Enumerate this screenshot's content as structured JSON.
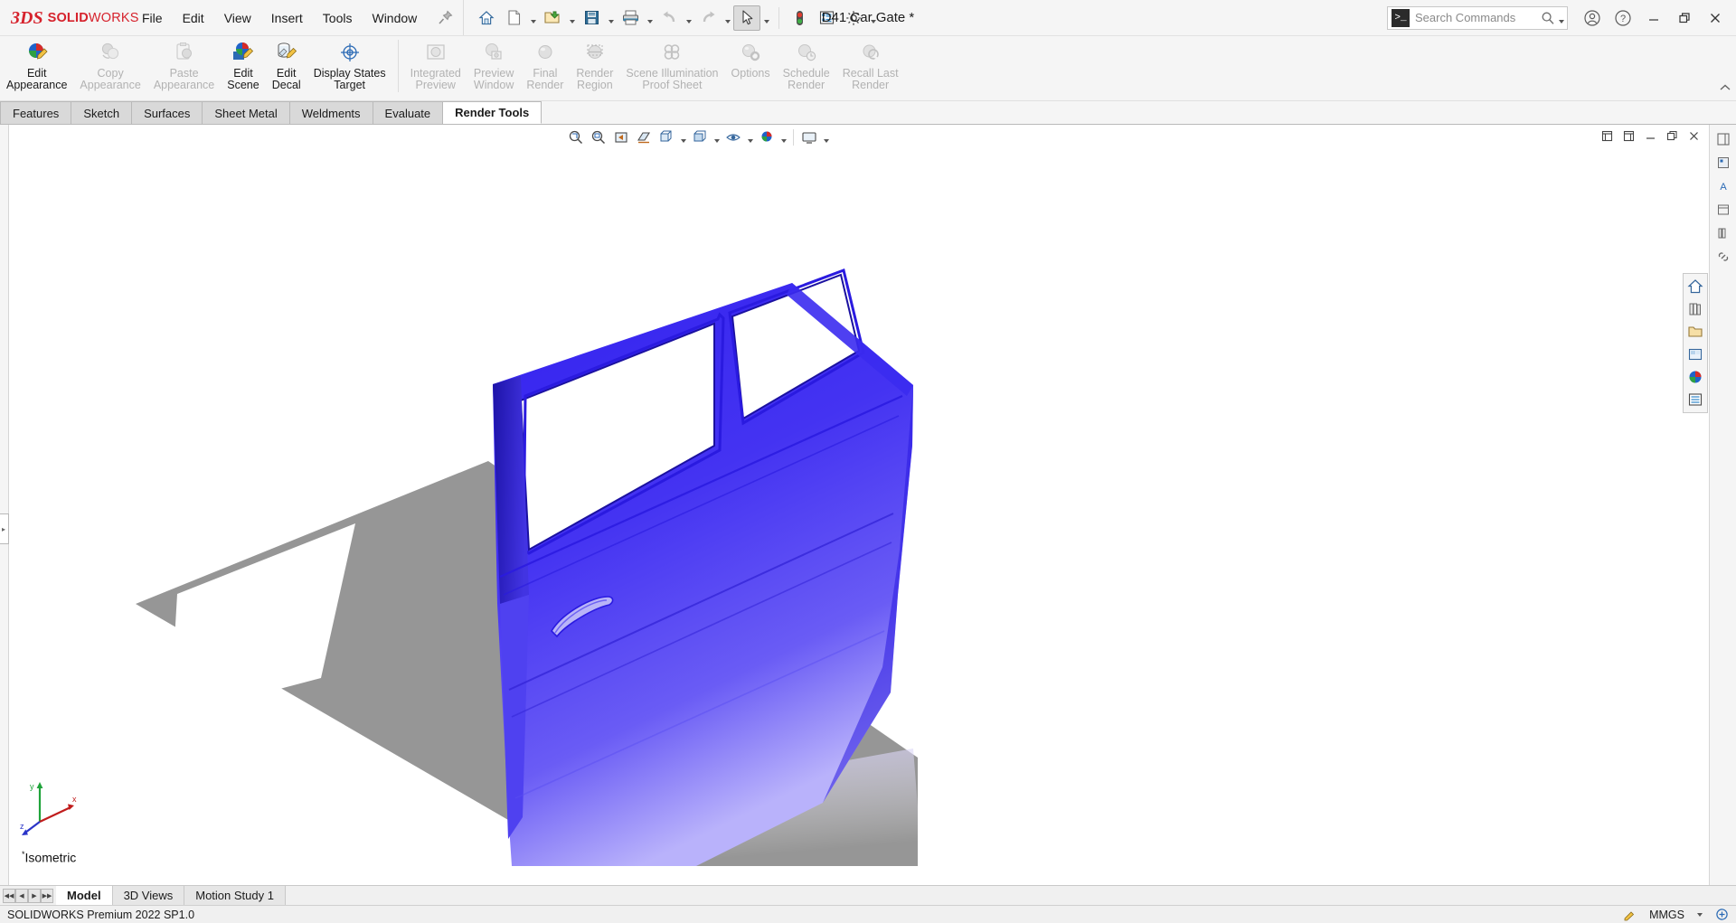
{
  "app": {
    "brand_bold": "SOLID",
    "brand_light": "WORKS",
    "accent_color": "#d6222c",
    "document_title": "D41 Car Gate *"
  },
  "menu": {
    "items": [
      {
        "label": "File",
        "name": "menu-file"
      },
      {
        "label": "Edit",
        "name": "menu-edit"
      },
      {
        "label": "View",
        "name": "menu-view"
      },
      {
        "label": "Insert",
        "name": "menu-insert"
      },
      {
        "label": "Tools",
        "name": "menu-tools"
      },
      {
        "label": "Window",
        "name": "menu-window"
      }
    ],
    "pin_icon": "pin-icon"
  },
  "quick_access": {
    "buttons": [
      {
        "name": "home-button",
        "icon": "home-icon",
        "has_caret": false
      },
      {
        "name": "new-document-button",
        "icon": "new-document-icon",
        "has_caret": true
      },
      {
        "name": "open-button",
        "icon": "open-folder-icon",
        "has_caret": true
      },
      {
        "name": "save-button",
        "icon": "save-floppy-icon",
        "has_caret": true
      },
      {
        "name": "print-button",
        "icon": "printer-icon",
        "has_caret": true
      },
      {
        "name": "undo-button",
        "icon": "undo-arrow-icon",
        "has_caret": true,
        "disabled": true
      },
      {
        "name": "redo-button",
        "icon": "redo-arrow-icon",
        "has_caret": true,
        "disabled": true
      },
      {
        "name": "select-button",
        "icon": "cursor-arrow-icon",
        "has_caret": true,
        "selected": true
      },
      {
        "name": "rebuild-button",
        "icon": "traffic-light-icon",
        "has_caret": false
      },
      {
        "name": "file-properties-button",
        "icon": "properties-list-icon",
        "has_caret": false
      },
      {
        "name": "options-button",
        "icon": "gear-icon",
        "has_caret": true
      }
    ]
  },
  "search": {
    "placeholder": "Search Commands",
    "prompt_glyph": ">_",
    "magnifier_icon": "search-icon",
    "caret_icon": "chevron-down-icon"
  },
  "window_controls": {
    "account_icon": "user-account-icon",
    "help_icon": "help-question-icon",
    "minimize": "–",
    "restore": "❐",
    "close": "✕"
  },
  "ribbon": {
    "groups": [
      {
        "name": "appearance-group",
        "buttons": [
          {
            "label": "Edit\nAppearance",
            "name": "edit-appearance-button",
            "icon": "appearance-sphere-pencil-icon",
            "disabled": false
          },
          {
            "label": "Copy\nAppearance",
            "name": "copy-appearance-button",
            "icon": "copy-appearance-icon",
            "disabled": true
          },
          {
            "label": "Paste\nAppearance",
            "name": "paste-appearance-button",
            "icon": "paste-appearance-icon",
            "disabled": true
          },
          {
            "label": "Edit\nScene",
            "name": "edit-scene-button",
            "icon": "scene-icon",
            "disabled": false
          },
          {
            "label": "Edit\nDecal",
            "name": "edit-decal-button",
            "icon": "decal-icon",
            "disabled": false
          },
          {
            "label": "Display States",
            "name": "display-states-button",
            "icon": "display-states-target-icon",
            "disabled": false,
            "sublabel": "Target"
          }
        ]
      },
      {
        "name": "render-group",
        "buttons": [
          {
            "label": "Integrated\nPreview",
            "name": "integrated-preview-button",
            "icon": "integrated-preview-icon",
            "disabled": true
          },
          {
            "label": "Preview\nWindow",
            "name": "preview-window-button",
            "icon": "preview-window-icon",
            "disabled": true
          },
          {
            "label": "Final\nRender",
            "name": "final-render-button",
            "icon": "final-render-sphere-icon",
            "disabled": true
          },
          {
            "label": "Render\nRegion",
            "name": "render-region-button",
            "icon": "render-region-icon",
            "disabled": true
          },
          {
            "label": "Scene Illumination\nProof Sheet",
            "name": "scene-illumination-proof-sheet-button",
            "icon": "proof-sheet-spheres-icon",
            "disabled": true
          },
          {
            "label": "Options",
            "name": "render-options-button",
            "icon": "render-options-gear-icon",
            "disabled": true
          },
          {
            "label": "Schedule\nRender",
            "name": "schedule-render-button",
            "icon": "schedule-render-icon",
            "disabled": true
          },
          {
            "label": "Recall Last\nRender",
            "name": "recall-last-render-button",
            "icon": "recall-last-render-icon",
            "disabled": true
          }
        ]
      }
    ],
    "collapse_icon": "chevron-up-icon"
  },
  "command_tabs": [
    {
      "label": "Features",
      "name": "tab-features",
      "active": false
    },
    {
      "label": "Sketch",
      "name": "tab-sketch",
      "active": false
    },
    {
      "label": "Surfaces",
      "name": "tab-surfaces",
      "active": false
    },
    {
      "label": "Sheet Metal",
      "name": "tab-sheet-metal",
      "active": false
    },
    {
      "label": "Weldments",
      "name": "tab-weldments",
      "active": false
    },
    {
      "label": "Evaluate",
      "name": "tab-evaluate",
      "active": false
    },
    {
      "label": "Render Tools",
      "name": "tab-render-tools",
      "active": true
    }
  ],
  "view_toolbar": {
    "buttons": [
      {
        "name": "zoom-to-fit-button",
        "icon": "zoom-to-fit-icon",
        "caret": false
      },
      {
        "name": "zoom-to-area-button",
        "icon": "zoom-to-area-icon",
        "caret": false
      },
      {
        "name": "previous-view-button",
        "icon": "previous-view-icon",
        "caret": false
      },
      {
        "name": "section-view-button",
        "icon": "section-view-icon",
        "caret": false
      },
      {
        "name": "view-orientation-button",
        "icon": "view-orientation-cube-icon",
        "caret": true
      },
      {
        "name": "display-style-button",
        "icon": "display-style-icon",
        "caret": true
      },
      {
        "name": "hide-show-items-button",
        "icon": "hide-show-eye-icon",
        "caret": true
      },
      {
        "name": "apply-scene-button",
        "icon": "apply-scene-sphere-icon",
        "caret": true
      },
      {
        "name": "view-settings-button",
        "icon": "view-settings-screen-icon",
        "caret": true
      }
    ]
  },
  "document_window_buttons": [
    {
      "name": "restore-doc-button",
      "icon": "restore-window-icon"
    },
    {
      "name": "maximize-doc-button",
      "icon": "maximize-window-icon"
    },
    {
      "name": "minimize-doc-button",
      "icon": "minimize-window-icon"
    },
    {
      "name": "tile-doc-button",
      "icon": "tile-window-icon"
    },
    {
      "name": "close-doc-button",
      "icon": "close-doc-icon"
    }
  ],
  "task_pane": {
    "icons": [
      {
        "name": "solidworks-resources-icon"
      },
      {
        "name": "design-library-icon"
      },
      {
        "name": "file-explorer-icon"
      },
      {
        "name": "view-palette-icon"
      },
      {
        "name": "appearances-scenes-decals-icon"
      },
      {
        "name": "custom-properties-icon"
      }
    ],
    "strip_icons": [
      {
        "name": "task-pane-expand-icon"
      },
      {
        "name": "appearance-swatch-icon"
      },
      {
        "name": "annotation-a-icon"
      },
      {
        "name": "display-pane-icon"
      },
      {
        "name": "library-icon"
      },
      {
        "name": "linked-icon"
      }
    ]
  },
  "viewport": {
    "view_label_prefix": "*",
    "view_label": "Isometric",
    "triad_axes": [
      {
        "label": "y",
        "color": "#1fa33a"
      },
      {
        "label": "x",
        "color": "#c01c1c"
      },
      {
        "label": "z",
        "color": "#2a34c8"
      }
    ],
    "model": {
      "name": "car-door-model",
      "color": "#3322ee",
      "highlight_color": "#8a86f5",
      "shadow_color": "#8d8d8d"
    }
  },
  "bottom_tabs": {
    "nav": [
      "◀◀",
      "◀",
      "▶",
      "▶▶"
    ],
    "tabs": [
      {
        "label": "Model",
        "name": "bottom-tab-model",
        "active": true
      },
      {
        "label": "3D Views",
        "name": "bottom-tab-3d-views",
        "active": false
      },
      {
        "label": "Motion Study 1",
        "name": "bottom-tab-motion-study-1",
        "active": false
      }
    ]
  },
  "status_bar": {
    "left_text": "SOLIDWORKS Premium 2022 SP1.0",
    "units": "MMGS",
    "units_caret_icon": "chevron-down-icon",
    "edit_icon": "edit-pencil-icon",
    "status_icon": "status-glyph-icon"
  }
}
